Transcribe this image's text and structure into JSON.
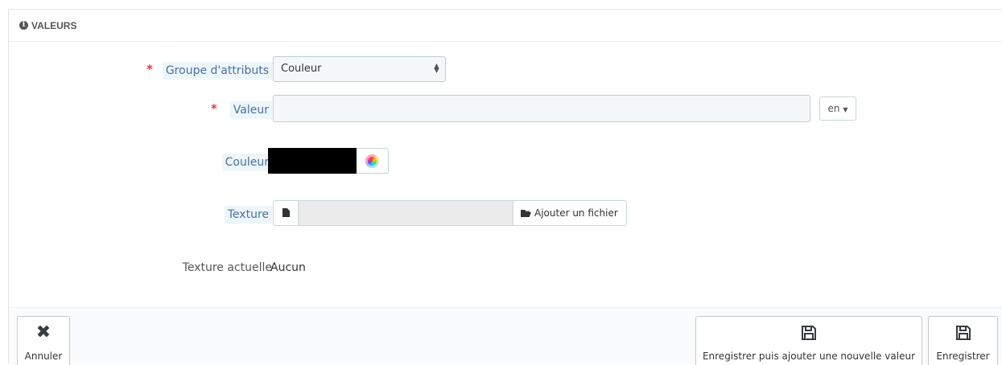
{
  "panel": {
    "heading": "VALEURS",
    "heading_icon": "info-circle-icon"
  },
  "form": {
    "attribute_group": {
      "label": "Groupe d'attributs",
      "required": true,
      "selected": "Couleur"
    },
    "value": {
      "label": "Valeur",
      "required": true,
      "input_value": "",
      "language": "en"
    },
    "color": {
      "label": "Couleur",
      "swatch_color": "#000000",
      "picker_icon": "color-wheel-icon"
    },
    "texture": {
      "label": "Texture",
      "file_icon": "file-icon",
      "button_icon": "folder-open-icon",
      "button_label": "Ajouter un fichier"
    },
    "current_texture": {
      "label": "Texture actuelle",
      "value": "Aucun"
    }
  },
  "footer": {
    "cancel_label": "Annuler",
    "cancel_icon": "close-icon",
    "save_and_new_label": "Enregistrer puis ajouter une nouvelle valeur",
    "save_and_new_icon": "save-icon",
    "save_label": "Enregistrer",
    "save_icon": "save-icon"
  }
}
